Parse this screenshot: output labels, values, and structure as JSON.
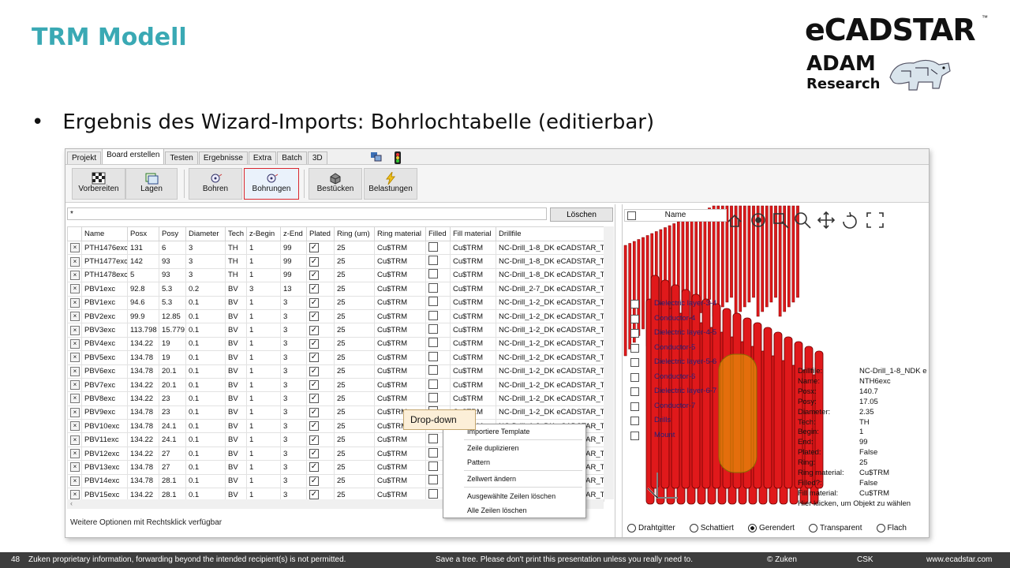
{
  "slide": {
    "title": "TRM Modell",
    "bullet": "Ergebnis des Wizard-Imports: Bohrlochtabelle (editierbar)",
    "callout": "Drop-down"
  },
  "logo": {
    "brand": "eCADSTAR",
    "tm": "™",
    "partner1": "ADAM",
    "partner2": "Research"
  },
  "app": {
    "tabs": [
      "Projekt",
      "Board erstellen",
      "Testen",
      "Ergebnisse",
      "Extra",
      "Batch",
      "3D"
    ],
    "active_tab": "Board erstellen",
    "ribbon": [
      {
        "label": "Vorbereiten",
        "icon": "checker-icon"
      },
      {
        "label": "Lagen",
        "icon": "layers-icon"
      },
      {
        "label": "Bohren",
        "icon": "drill-icon"
      },
      {
        "label": "Bohrungen",
        "icon": "holes-icon",
        "selected": true
      },
      {
        "label": "Bestücken",
        "icon": "component-icon"
      },
      {
        "label": "Belastungen",
        "icon": "lightning-icon"
      }
    ],
    "filter_value": "*",
    "clear_button": "Löschen",
    "columns": [
      "",
      "Name",
      "Posx",
      "Posy",
      "Diameter",
      "Tech",
      "z-Begin",
      "z-End",
      "Plated",
      "Ring (um)",
      "Ring material",
      "Filled",
      "Fill material",
      "Drillfile"
    ],
    "rows": [
      [
        "PTH1476exc",
        "131",
        "6",
        "3",
        "TH",
        "1",
        "99",
        "25",
        "Cu$TRM",
        "Cu$TRM",
        "NC-Drill_1-8_DK eCADSTAR_T"
      ],
      [
        "PTH1477exc",
        "142",
        "93",
        "3",
        "TH",
        "1",
        "99",
        "25",
        "Cu$TRM",
        "Cu$TRM",
        "NC-Drill_1-8_DK eCADSTAR_T"
      ],
      [
        "PTH1478exc",
        "5",
        "93",
        "3",
        "TH",
        "1",
        "99",
        "25",
        "Cu$TRM",
        "Cu$TRM",
        "NC-Drill_1-8_DK eCADSTAR_T"
      ],
      [
        "PBV1exc",
        "92.8",
        "5.3",
        "0.2",
        "BV",
        "3",
        "13",
        "25",
        "Cu$TRM",
        "Cu$TRM",
        "NC-Drill_2-7_DK eCADSTAR_T"
      ],
      [
        "PBV1exc",
        "94.6",
        "5.3",
        "0.1",
        "BV",
        "1",
        "3",
        "25",
        "Cu$TRM",
        "Cu$TRM",
        "NC-Drill_1-2_DK eCADSTAR_T"
      ],
      [
        "PBV2exc",
        "99.9",
        "12.85",
        "0.1",
        "BV",
        "1",
        "3",
        "25",
        "Cu$TRM",
        "Cu$TRM",
        "NC-Drill_1-2_DK eCADSTAR_T"
      ],
      [
        "PBV3exc",
        "113.798",
        "15.779",
        "0.1",
        "BV",
        "1",
        "3",
        "25",
        "Cu$TRM",
        "Cu$TRM",
        "NC-Drill_1-2_DK eCADSTAR_T"
      ],
      [
        "PBV4exc",
        "134.22",
        "19",
        "0.1",
        "BV",
        "1",
        "3",
        "25",
        "Cu$TRM",
        "Cu$TRM",
        "NC-Drill_1-2_DK eCADSTAR_T"
      ],
      [
        "PBV5exc",
        "134.78",
        "19",
        "0.1",
        "BV",
        "1",
        "3",
        "25",
        "Cu$TRM",
        "Cu$TRM",
        "NC-Drill_1-2_DK eCADSTAR_T"
      ],
      [
        "PBV6exc",
        "134.78",
        "20.1",
        "0.1",
        "BV",
        "1",
        "3",
        "25",
        "Cu$TRM",
        "Cu$TRM",
        "NC-Drill_1-2_DK eCADSTAR_T"
      ],
      [
        "PBV7exc",
        "134.22",
        "20.1",
        "0.1",
        "BV",
        "1",
        "3",
        "25",
        "Cu$TRM",
        "Cu$TRM",
        "NC-Drill_1-2_DK eCADSTAR_T"
      ],
      [
        "PBV8exc",
        "134.22",
        "23",
        "0.1",
        "BV",
        "1",
        "3",
        "25",
        "Cu$TRM",
        "Cu$TRM",
        "NC-Drill_1-2_DK eCADSTAR_T"
      ],
      [
        "PBV9exc",
        "134.78",
        "23",
        "0.1",
        "BV",
        "1",
        "3",
        "25",
        "Cu$TRM",
        "Cu$TRM",
        "NC-Drill_1-2_DK eCADSTAR_T"
      ],
      [
        "PBV10exc",
        "134.78",
        "24.1",
        "0.1",
        "BV",
        "1",
        "3",
        "25",
        "Cu$TRM",
        "Cu$TRM",
        "NC-Drill_1-2_DK eCADSTAR_T"
      ],
      [
        "PBV11exc",
        "134.22",
        "24.1",
        "0.1",
        "BV",
        "1",
        "3",
        "25",
        "Cu$TRM",
        "Cu$TRM",
        "NC-Drill_1-2_DK eCADSTAR_T"
      ],
      [
        "PBV12exc",
        "134.22",
        "27",
        "0.1",
        "BV",
        "1",
        "3",
        "25",
        "Cu$TRM",
        "Cu$TRM",
        "NC-Drill_1-2_DK eCADSTAR_T"
      ],
      [
        "PBV13exc",
        "134.78",
        "27",
        "0.1",
        "BV",
        "1",
        "3",
        "25",
        "Cu$TRM",
        "Cu$TRM",
        "NC-Drill_1-2_DK eCADSTAR_T"
      ],
      [
        "PBV14exc",
        "134.78",
        "28.1",
        "0.1",
        "BV",
        "1",
        "3",
        "25",
        "Cu$TRM",
        "Cu$TRM",
        "NC-Drill_1-2_DK eCADSTAR_T"
      ],
      [
        "PBV15exc",
        "134.22",
        "28.1",
        "0.1",
        "BV",
        "1",
        "3",
        "25",
        "Cu$TRM",
        "Cu$TRM",
        "NC-Drill_1-2_DK eCADSTAR_T"
      ]
    ],
    "context_menu": [
      "Importiere Template",
      "Zeile duplizieren",
      "Pattern",
      "Zellwert ändern",
      "Ausgewählte Zeilen löschen",
      "Alle Zeilen löschen"
    ],
    "status_text": "Weitere Optionen mit Rechtsklick verfügbar",
    "layer_header": "Name",
    "layers": [
      "Dielectric layer-3-4",
      "Conductor-4",
      "Dielectric layer-4-5",
      "Conductor-5",
      "Dielectric layer-5-6",
      "Conductor-6",
      "Dielectric layer-6-7",
      "Conductor-7",
      "Drills",
      "Mount"
    ],
    "info": [
      [
        "Drillfile:",
        "NC-Drill_1-8_NDK e"
      ],
      [
        "Name:",
        "NTH6exc"
      ],
      [
        "Posx:",
        "140.7"
      ],
      [
        "Posy:",
        "17.05"
      ],
      [
        "Diameter:",
        "2.35"
      ],
      [
        "Tech:",
        "TH"
      ],
      [
        "Begin:",
        "1"
      ],
      [
        "End:",
        "99"
      ],
      [
        "Plated:",
        "False"
      ],
      [
        "Ring:",
        "25"
      ],
      [
        "Ring material:",
        "Cu$TRM"
      ],
      [
        "Filled?:",
        "False"
      ],
      [
        "Fill material:",
        "Cu$TRM"
      ]
    ],
    "info_hint": "Hier klicken, um Objekt zu wählen",
    "view_modes": [
      "Drahtgitter",
      "Schattiert",
      "Gerendert",
      "Transparent",
      "Flach"
    ],
    "view_mode_selected": "Gerendert"
  },
  "footer": {
    "page": "48",
    "notice": "Zuken proprietary information, forwarding beyond the intended recipient(s) is not permitted.",
    "tree": "Save a tree. Please don't print this presentation unless you really need to.",
    "copyright": "© Zuken",
    "code": "CSK",
    "url": "www.ecadstar.com"
  },
  "colors": {
    "title": "#3aa9b4",
    "drill_red": "#e0191b",
    "highlight": "#e8b400",
    "footer_bg": "#3d3d3d"
  }
}
